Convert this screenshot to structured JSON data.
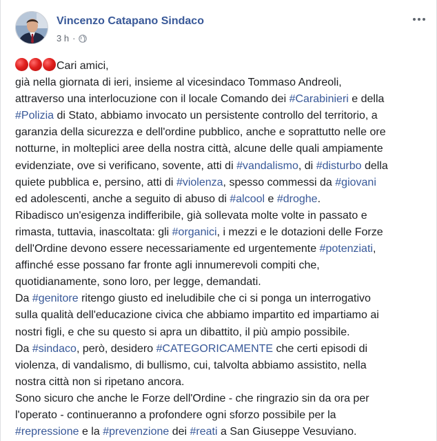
{
  "post": {
    "author": "Vincenzo Catapano Sindaco",
    "time": "3 h",
    "separator": "·",
    "privacy_icon": "globe-icon",
    "more_icon": "more-options-icon",
    "emoji": "red-circle-icon",
    "accent_color": "#385898",
    "lines": [
      [
        {
          "t": "Cari amici,"
        }
      ],
      [
        {
          "t": "già nella giornata di ieri, insieme al vicesindaco Tommaso Andreoli,"
        }
      ],
      [
        {
          "t": "attraverso una interlocuzione con il locale Comando dei "
        },
        {
          "t": "#Carabinieri",
          "h": true
        },
        {
          "t": " e della"
        }
      ],
      [
        {
          "t": "#Polizia",
          "h": true
        },
        {
          "t": " di Stato, abbiamo invocato un persistente controllo del territorio, a"
        }
      ],
      [
        {
          "t": "garanzia della sicurezza e dell'ordine pubblico, anche e soprattutto nelle ore"
        }
      ],
      [
        {
          "t": "notturne, in molteplici aree della nostra città, alcune delle quali ampiamente"
        }
      ],
      [
        {
          "t": "evidenziate, ove si verificano, sovente, atti di "
        },
        {
          "t": "#vandalismo",
          "h": true
        },
        {
          "t": ", di "
        },
        {
          "t": "#disturbo",
          "h": true
        },
        {
          "t": " della"
        }
      ],
      [
        {
          "t": "quiete pubblica e, persino, atti di "
        },
        {
          "t": "#violenza",
          "h": true
        },
        {
          "t": ", spesso commessi da "
        },
        {
          "t": "#giovani",
          "h": true
        }
      ],
      [
        {
          "t": "ed adolescenti, anche a seguito di abuso di "
        },
        {
          "t": "#alcool",
          "h": true
        },
        {
          "t": " e "
        },
        {
          "t": "#droghe",
          "h": true
        },
        {
          "t": "."
        }
      ],
      [
        {
          "t": "Ribadisco un'esigenza indifferibile, già sollevata molte volte in passato e"
        }
      ],
      [
        {
          "t": "rimasta, tuttavia, inascoltata: gli "
        },
        {
          "t": "#organici",
          "h": true
        },
        {
          "t": ", i mezzi e le dotazioni delle Forze"
        }
      ],
      [
        {
          "t": "dell'Ordine devono essere necessariamente ed urgentemente "
        },
        {
          "t": "#potenziati",
          "h": true
        },
        {
          "t": ","
        }
      ],
      [
        {
          "t": "affinché esse possano far fronte agli innumerevoli compiti che,"
        }
      ],
      [
        {
          "t": "quotidianamente, sono loro, per legge, demandati."
        }
      ],
      [
        {
          "t": "Da "
        },
        {
          "t": "#genitore",
          "h": true
        },
        {
          "t": " ritengo giusto ed ineludibile che ci si ponga un interrogativo"
        }
      ],
      [
        {
          "t": "sulla qualità dell'educazione civica che abbiamo impartito ed impartiamo ai"
        }
      ],
      [
        {
          "t": "nostri figli, e che su questo si apra un dibattito, il più ampio possibile."
        }
      ],
      [
        {
          "t": "Da "
        },
        {
          "t": "#sindaco",
          "h": true
        },
        {
          "t": ", però, desidero "
        },
        {
          "t": "#CATEGORICAMENTE",
          "h": true
        },
        {
          "t": " che certi episodi di"
        }
      ],
      [
        {
          "t": "violenza, di vandalismo, di bullismo, cui, talvolta abbiamo assistito, nella"
        }
      ],
      [
        {
          "t": "nostra città non si ripetano ancora."
        }
      ],
      [
        {
          "t": "Sono sicuro che anche le Forze dell'Ordine - che ringrazio sin da ora per"
        }
      ],
      [
        {
          "t": "l'operato - continueranno a profondere ogni sforzo possibile per la"
        }
      ],
      [
        {
          "t": "#repressione",
          "h": true
        },
        {
          "t": " e la "
        },
        {
          "t": "#prevenzione",
          "h": true
        },
        {
          "t": " dei "
        },
        {
          "t": "#reati",
          "h": true
        },
        {
          "t": " a San Giuseppe Vesuviano."
        }
      ]
    ]
  }
}
